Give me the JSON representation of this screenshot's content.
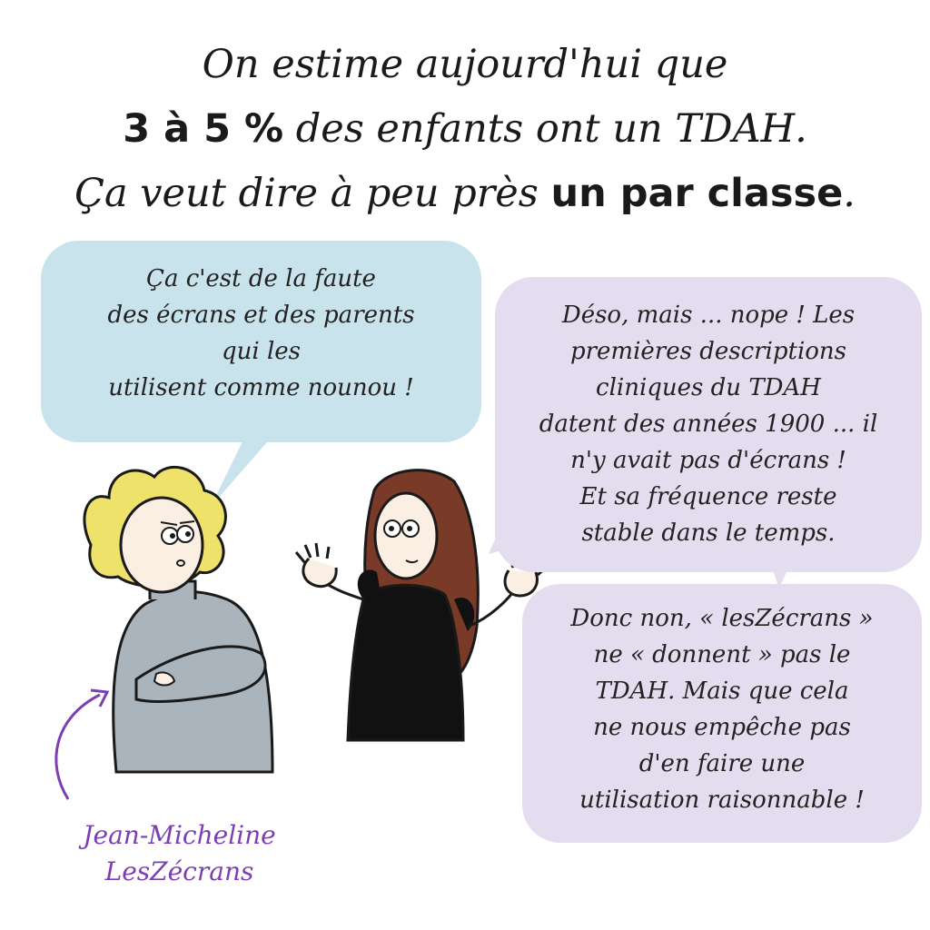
{
  "headline": {
    "line1": "On estime aujourd'hui que",
    "line2_bold": "3 à 5 %",
    "line2_rest": " des enfants ont un TDAH.",
    "line3_start": "Ça veut dire à peu près ",
    "line3_bold": "un par classe",
    "line3_end": "."
  },
  "bubble_left": {
    "lines": [
      "Ça c'est de la faute",
      "des écrans et des parents",
      "qui les",
      "utilisent comme nounou !"
    ]
  },
  "bubble_right_top": {
    "lines": [
      "Déso, mais ... nope ! Les",
      "premières descriptions",
      "cliniques du TDAH",
      "datent des années 1900 ... il",
      "n'y avait pas d'écrans !",
      "Et sa fréquence reste",
      "stable dans le temps."
    ]
  },
  "bubble_right_bottom": {
    "lines": [
      "Donc non, « lesZécrans »",
      "ne « donnent » pas le",
      "TDAH. Mais que cela",
      "ne nous empêche pas",
      "d'en faire une",
      "utilisation raisonnable !"
    ]
  },
  "caption": {
    "lines": [
      "Jean-Micheline",
      "LesZécrans"
    ]
  },
  "colors": {
    "bubble_blue": "#c9e3ec",
    "bubble_lilac": "#e4ddef",
    "caption_purple": "#7b3fb3",
    "hair_blonde": "#eee26a",
    "hair_brown": "#7a3a28",
    "sweater_grey": "#a9b4bd",
    "shirt_black": "#111111",
    "skin": "#fbefe3"
  }
}
